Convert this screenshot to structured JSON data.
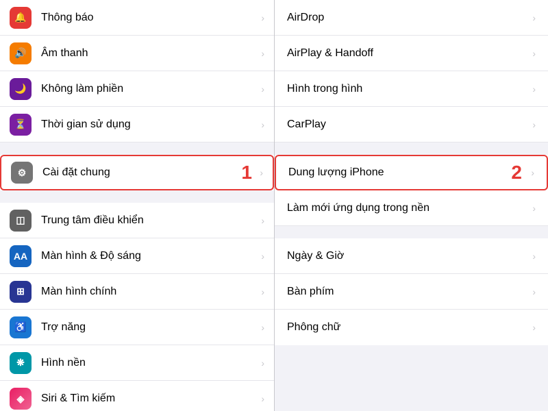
{
  "leftPanel": {
    "items": [
      {
        "id": "thong-bao",
        "label": "Thông báo",
        "iconColor": "icon-red",
        "iconGlyph": "🔔",
        "hasChevron": true,
        "highlighted": false
      },
      {
        "id": "am-thanh",
        "label": "Âm thanh",
        "iconColor": "icon-orange",
        "iconGlyph": "🔊",
        "hasChevron": true,
        "highlighted": false
      },
      {
        "id": "khong-lam-phien",
        "label": "Không làm phiền",
        "iconColor": "icon-purple-dark",
        "iconGlyph": "🌙",
        "hasChevron": true,
        "highlighted": false
      },
      {
        "id": "thoi-gian-su-dung",
        "label": "Thời gian sử dụng",
        "iconColor": "icon-purple",
        "iconGlyph": "⏳",
        "hasChevron": true,
        "highlighted": false
      },
      {
        "id": "cai-dat-chung",
        "label": "Cài đặt chung",
        "iconColor": "icon-gray",
        "iconGlyph": "⚙️",
        "hasChevron": true,
        "highlighted": true,
        "badge": "1"
      },
      {
        "id": "trung-tam-dieu-khien",
        "label": "Trung tâm điều khiển",
        "iconColor": "icon-gray2",
        "iconGlyph": "⊞",
        "hasChevron": true,
        "highlighted": false
      },
      {
        "id": "man-hinh-do-sang",
        "label": "Màn hình & Độ sáng",
        "iconColor": "icon-blue",
        "iconGlyph": "AA",
        "hasChevron": true,
        "highlighted": false
      },
      {
        "id": "man-hinh-chinh",
        "label": "Màn hình chính",
        "iconColor": "icon-indigo",
        "iconGlyph": "⊞",
        "hasChevron": true,
        "highlighted": false
      },
      {
        "id": "tro-nang",
        "label": "Trợ năng",
        "iconColor": "icon-blue2",
        "iconGlyph": "♿",
        "hasChevron": true,
        "highlighted": false
      },
      {
        "id": "hinh-nen",
        "label": "Hình nền",
        "iconColor": "icon-cyan",
        "iconGlyph": "✿",
        "hasChevron": true,
        "highlighted": false
      },
      {
        "id": "siri-tim-kiem",
        "label": "Siri & Tìm kiếm",
        "iconColor": "icon-gradient-pink",
        "iconGlyph": "◈",
        "hasChevron": true,
        "highlighted": false
      }
    ]
  },
  "rightPanel": {
    "items": [
      {
        "id": "airdrop",
        "label": "AirDrop",
        "hasChevron": true,
        "highlighted": false,
        "badge": ""
      },
      {
        "id": "airplay-handoff",
        "label": "AirPlay & Handoff",
        "hasChevron": true,
        "highlighted": false,
        "badge": ""
      },
      {
        "id": "hinh-trong-hinh",
        "label": "Hình trong hình",
        "hasChevron": true,
        "highlighted": false,
        "badge": ""
      },
      {
        "id": "carplay",
        "label": "CarPlay",
        "hasChevron": true,
        "highlighted": false,
        "badge": ""
      },
      {
        "id": "dung-luong-iphone",
        "label": "Dung lượng iPhone",
        "hasChevron": true,
        "highlighted": true,
        "badge": "2"
      },
      {
        "id": "lam-moi-ung-dung",
        "label": "Làm mới ứng dụng trong nền",
        "hasChevron": true,
        "highlighted": false,
        "badge": ""
      },
      {
        "id": "ngay-gio",
        "label": "Ngày & Giờ",
        "hasChevron": true,
        "highlighted": false,
        "badge": ""
      },
      {
        "id": "ban-phim",
        "label": "Bàn phím",
        "hasChevron": true,
        "highlighted": false,
        "badge": ""
      },
      {
        "id": "phong-chu",
        "label": "Phông chữ",
        "hasChevron": true,
        "highlighted": false,
        "badge": ""
      }
    ]
  },
  "icons": {
    "chevron": "›"
  }
}
